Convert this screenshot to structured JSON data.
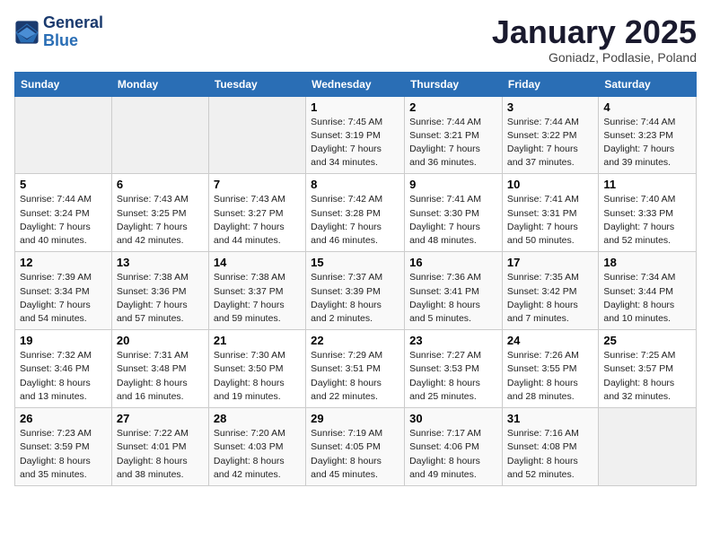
{
  "logo": {
    "line1": "General",
    "line2": "Blue"
  },
  "title": "January 2025",
  "subtitle": "Goniadz, Podlasie, Poland",
  "weekdays": [
    "Sunday",
    "Monday",
    "Tuesday",
    "Wednesday",
    "Thursday",
    "Friday",
    "Saturday"
  ],
  "weeks": [
    [
      {
        "day": "",
        "info": ""
      },
      {
        "day": "",
        "info": ""
      },
      {
        "day": "",
        "info": ""
      },
      {
        "day": "1",
        "info": "Sunrise: 7:45 AM\nSunset: 3:19 PM\nDaylight: 7 hours\nand 34 minutes."
      },
      {
        "day": "2",
        "info": "Sunrise: 7:44 AM\nSunset: 3:21 PM\nDaylight: 7 hours\nand 36 minutes."
      },
      {
        "day": "3",
        "info": "Sunrise: 7:44 AM\nSunset: 3:22 PM\nDaylight: 7 hours\nand 37 minutes."
      },
      {
        "day": "4",
        "info": "Sunrise: 7:44 AM\nSunset: 3:23 PM\nDaylight: 7 hours\nand 39 minutes."
      }
    ],
    [
      {
        "day": "5",
        "info": "Sunrise: 7:44 AM\nSunset: 3:24 PM\nDaylight: 7 hours\nand 40 minutes."
      },
      {
        "day": "6",
        "info": "Sunrise: 7:43 AM\nSunset: 3:25 PM\nDaylight: 7 hours\nand 42 minutes."
      },
      {
        "day": "7",
        "info": "Sunrise: 7:43 AM\nSunset: 3:27 PM\nDaylight: 7 hours\nand 44 minutes."
      },
      {
        "day": "8",
        "info": "Sunrise: 7:42 AM\nSunset: 3:28 PM\nDaylight: 7 hours\nand 46 minutes."
      },
      {
        "day": "9",
        "info": "Sunrise: 7:41 AM\nSunset: 3:30 PM\nDaylight: 7 hours\nand 48 minutes."
      },
      {
        "day": "10",
        "info": "Sunrise: 7:41 AM\nSunset: 3:31 PM\nDaylight: 7 hours\nand 50 minutes."
      },
      {
        "day": "11",
        "info": "Sunrise: 7:40 AM\nSunset: 3:33 PM\nDaylight: 7 hours\nand 52 minutes."
      }
    ],
    [
      {
        "day": "12",
        "info": "Sunrise: 7:39 AM\nSunset: 3:34 PM\nDaylight: 7 hours\nand 54 minutes."
      },
      {
        "day": "13",
        "info": "Sunrise: 7:38 AM\nSunset: 3:36 PM\nDaylight: 7 hours\nand 57 minutes."
      },
      {
        "day": "14",
        "info": "Sunrise: 7:38 AM\nSunset: 3:37 PM\nDaylight: 7 hours\nand 59 minutes."
      },
      {
        "day": "15",
        "info": "Sunrise: 7:37 AM\nSunset: 3:39 PM\nDaylight: 8 hours\nand 2 minutes."
      },
      {
        "day": "16",
        "info": "Sunrise: 7:36 AM\nSunset: 3:41 PM\nDaylight: 8 hours\nand 5 minutes."
      },
      {
        "day": "17",
        "info": "Sunrise: 7:35 AM\nSunset: 3:42 PM\nDaylight: 8 hours\nand 7 minutes."
      },
      {
        "day": "18",
        "info": "Sunrise: 7:34 AM\nSunset: 3:44 PM\nDaylight: 8 hours\nand 10 minutes."
      }
    ],
    [
      {
        "day": "19",
        "info": "Sunrise: 7:32 AM\nSunset: 3:46 PM\nDaylight: 8 hours\nand 13 minutes."
      },
      {
        "day": "20",
        "info": "Sunrise: 7:31 AM\nSunset: 3:48 PM\nDaylight: 8 hours\nand 16 minutes."
      },
      {
        "day": "21",
        "info": "Sunrise: 7:30 AM\nSunset: 3:50 PM\nDaylight: 8 hours\nand 19 minutes."
      },
      {
        "day": "22",
        "info": "Sunrise: 7:29 AM\nSunset: 3:51 PM\nDaylight: 8 hours\nand 22 minutes."
      },
      {
        "day": "23",
        "info": "Sunrise: 7:27 AM\nSunset: 3:53 PM\nDaylight: 8 hours\nand 25 minutes."
      },
      {
        "day": "24",
        "info": "Sunrise: 7:26 AM\nSunset: 3:55 PM\nDaylight: 8 hours\nand 28 minutes."
      },
      {
        "day": "25",
        "info": "Sunrise: 7:25 AM\nSunset: 3:57 PM\nDaylight: 8 hours\nand 32 minutes."
      }
    ],
    [
      {
        "day": "26",
        "info": "Sunrise: 7:23 AM\nSunset: 3:59 PM\nDaylight: 8 hours\nand 35 minutes."
      },
      {
        "day": "27",
        "info": "Sunrise: 7:22 AM\nSunset: 4:01 PM\nDaylight: 8 hours\nand 38 minutes."
      },
      {
        "day": "28",
        "info": "Sunrise: 7:20 AM\nSunset: 4:03 PM\nDaylight: 8 hours\nand 42 minutes."
      },
      {
        "day": "29",
        "info": "Sunrise: 7:19 AM\nSunset: 4:05 PM\nDaylight: 8 hours\nand 45 minutes."
      },
      {
        "day": "30",
        "info": "Sunrise: 7:17 AM\nSunset: 4:06 PM\nDaylight: 8 hours\nand 49 minutes."
      },
      {
        "day": "31",
        "info": "Sunrise: 7:16 AM\nSunset: 4:08 PM\nDaylight: 8 hours\nand 52 minutes."
      },
      {
        "day": "",
        "info": ""
      }
    ]
  ]
}
